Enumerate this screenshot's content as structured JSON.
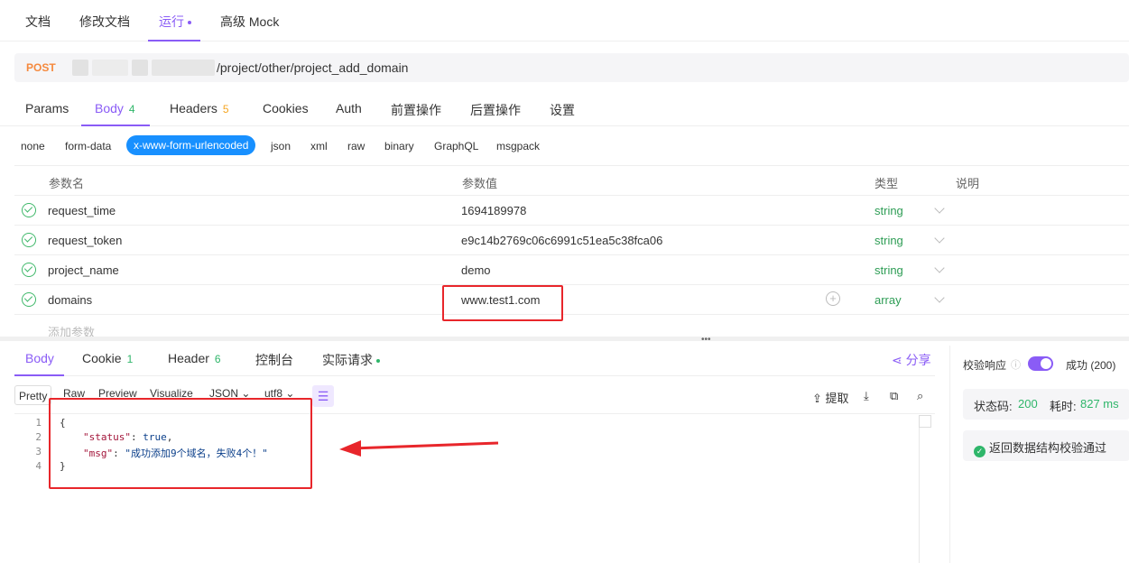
{
  "top_tabs": [
    "文档",
    "修改文档",
    "运行",
    "高级 Mock"
  ],
  "request": {
    "method": "POST",
    "url_path": "/project/other/project_add_domain"
  },
  "request_tabs": {
    "params": "Params",
    "body": "Body",
    "body_count": "4",
    "headers": "Headers",
    "headers_count": "5",
    "cookies": "Cookies",
    "auth": "Auth",
    "pre": "前置操作",
    "post": "后置操作",
    "settings": "设置"
  },
  "body_types": [
    "none",
    "form-data",
    "x-www-form-urlencoded",
    "json",
    "xml",
    "raw",
    "binary",
    "GraphQL",
    "msgpack"
  ],
  "params": {
    "headers": {
      "name": "参数名",
      "value": "参数值",
      "type": "类型",
      "desc": "说明"
    },
    "rows": [
      {
        "name": "request_time",
        "value": "1694189978",
        "type": "string"
      },
      {
        "name": "request_token",
        "value": "e9c14b2769c06c6991c51ea5c38fca06",
        "type": "string"
      },
      {
        "name": "project_name",
        "value": "demo",
        "type": "string"
      },
      {
        "name": "domains",
        "value": "www.test1.com",
        "type": "array"
      }
    ],
    "add_placeholder": "添加参数"
  },
  "response_tabs": {
    "body": "Body",
    "cookie": "Cookie",
    "cookie_count": "1",
    "header": "Header",
    "header_count": "6",
    "console": "控制台",
    "actual": "实际请求",
    "share": "分享"
  },
  "response_toolbar": {
    "modes": [
      "Pretty",
      "Raw",
      "Preview",
      "Visualize"
    ],
    "format": "JSON",
    "encoding": "utf8",
    "extract": "提取"
  },
  "response_body": {
    "line_numbers": [
      "1",
      "2",
      "3",
      "4"
    ],
    "open_brace": "{",
    "close_brace": "}",
    "status_key": "\"status\"",
    "status_value": "true",
    "msg_key": "\"msg\"",
    "msg_value": "\"成功添加9个域名，失败4个！\""
  },
  "sidebar": {
    "validate_label": "校验响应",
    "validate_on": true,
    "success_label": "成功 (200)",
    "status_code_label": "状态码:",
    "status_code": "200",
    "time_label": "耗时:",
    "time_value": "827 ms",
    "validation_message": "返回数据结构校验通过"
  },
  "colors": {
    "accent": "#8a5cf6",
    "method": "#f5893d",
    "success": "#2fb66a",
    "highlight": "#e8262b",
    "selected_body_type": "#1890ff"
  }
}
